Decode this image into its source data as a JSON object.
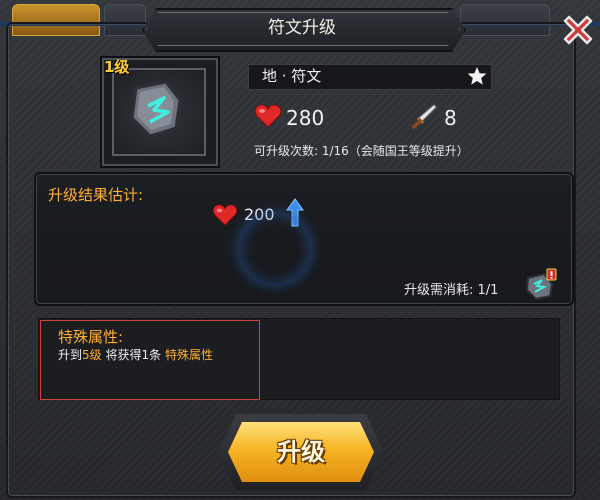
{
  "title": "符文升级",
  "item": {
    "level_label": "1级",
    "name": "地 · 符文",
    "icon": "rune-stone-icon",
    "hp": "280",
    "attack": "8",
    "upgrade_count_text": "可升级次数: 1/16（会随国王等级提升）"
  },
  "result": {
    "title": "升级结果估计:",
    "hp": "200",
    "cost_label": "升级需消耗: 1/1"
  },
  "special": {
    "title": "特殊属性:",
    "line_prefix": "升到",
    "line_level": "5级",
    "line_mid": "将获得1条",
    "line_attr": "特殊属性"
  },
  "button": {
    "upgrade_label": "升级"
  },
  "colors": {
    "accent_gold": "#ffb030",
    "level_yellow": "#ffcc33",
    "button_gold": "#f7b623",
    "highlight_red": "#c7423a",
    "close_red": "#d23a3a"
  }
}
